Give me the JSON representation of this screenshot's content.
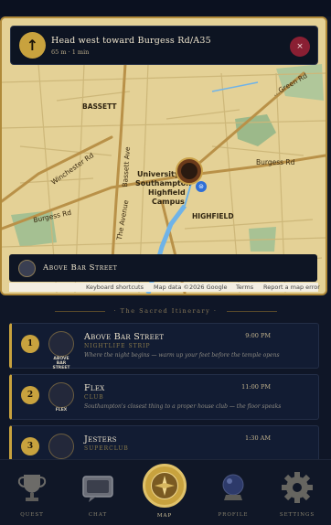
{
  "navigation": {
    "instruction": "Head west toward Burgess Rd/A35",
    "meta": "65 m · 1 min",
    "close_label": "×",
    "arrow": "↑"
  },
  "map": {
    "labels": {
      "bassett": "BASSETT",
      "winchester_rd": "Winchester Rd",
      "burgess_rd_left": "Burgess Rd",
      "burgess_rd_right": "Burgess Rd",
      "bassett_ave": "Bassett Ave",
      "the_avenue": "The Avenue",
      "university": "University of",
      "southampton": "Southampton",
      "highfield_campus": "Highfield",
      "campus": "Campus",
      "highfield": "HIGHFIELD",
      "greenfield": "...Green Rd"
    },
    "attribution": {
      "shortcuts": "Keyboard shortcuts",
      "data": "Map data ©2026 Google",
      "terms": "Terms",
      "report": "Report a map error"
    }
  },
  "destination": {
    "label": "Above Bar Street"
  },
  "itinerary": {
    "title": "· The Sacred Itinerary ·",
    "stops": [
      {
        "number": "1",
        "name": "Above Bar Street",
        "category": "NIGHTLIFE STRIP",
        "description": "Where the night begins — warm up your feet before the temple opens",
        "time": "9:00 PM",
        "thumb_caption": "ABOVE BAR STREET"
      },
      {
        "number": "2",
        "name": "Flex",
        "category": "CLUB",
        "description": "Southampton's closest thing to a proper house club — the floor speaks",
        "time": "11:00 PM",
        "thumb_caption": "FLEX"
      },
      {
        "number": "3",
        "name": "Jesters",
        "category": "SUPERCLUB",
        "description": "",
        "time": "1:30 AM",
        "thumb_caption": ""
      }
    ]
  },
  "tabs": [
    {
      "label": "QUEST",
      "icon": "trophy-icon"
    },
    {
      "label": "CHAT",
      "icon": "chat-icon"
    },
    {
      "label": "MAP",
      "icon": "compass-icon"
    },
    {
      "label": "PROFILE",
      "icon": "crystal-ball-icon"
    },
    {
      "label": "SETTINGS",
      "icon": "gear-icon"
    }
  ],
  "colors": {
    "accent_gold": "#c8a23e",
    "background": "#0f1627",
    "close_red": "#8a1f33"
  }
}
